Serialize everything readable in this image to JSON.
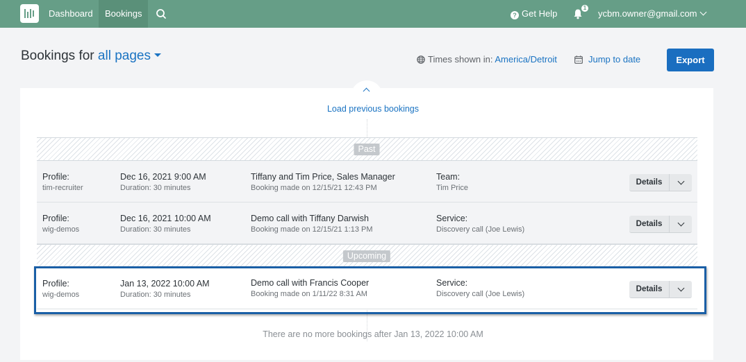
{
  "nav": {
    "items": [
      {
        "label": "Dashboard",
        "active": false
      },
      {
        "label": "Bookings",
        "active": true
      }
    ],
    "search_icon": "search-icon",
    "help_label": "Get Help",
    "notifications_count": "1",
    "user_email": "ycbm.owner@gmail.com"
  },
  "header": {
    "title_prefix": "Bookings for",
    "scope": "all pages",
    "times_shown_label": "Times shown in:",
    "timezone": "America/Detroit",
    "jump_to_date": "Jump to date",
    "export_label": "Export"
  },
  "list": {
    "load_previous": "Load previous bookings",
    "past_label": "Past",
    "upcoming_label": "Upcoming",
    "details_label": "Details",
    "past": [
      {
        "profile_label": "Profile:",
        "profile": "tim-recruiter",
        "datetime": "Dec 16, 2021 9:00 AM",
        "duration": "Duration: 30 minutes",
        "title": "Tiffany and Tim Price, Sales Manager",
        "booked": "Booking made on 12/15/21 12:43 PM",
        "type_label": "Team:",
        "type_value": "Tim Price"
      },
      {
        "profile_label": "Profile:",
        "profile": "wig-demos",
        "datetime": "Dec 16, 2021 10:00 AM",
        "duration": "Duration: 30 minutes",
        "title": "Demo call with Tiffany Darwish",
        "booked": "Booking made on 12/15/21 1:13 PM",
        "type_label": "Service:",
        "type_value": "Discovery call (Joe Lewis)"
      }
    ],
    "upcoming": [
      {
        "profile_label": "Profile:",
        "profile": "wig-demos",
        "datetime": "Jan 13, 2022 10:00 AM",
        "duration": "Duration: 30 minutes",
        "title": "Demo call with Francis Cooper",
        "booked": "Booking made on 1/11/22 8:31 AM",
        "type_label": "Service:",
        "type_value": "Discovery call (Joe Lewis)"
      }
    ],
    "no_more": "There are no more bookings after Jan 13, 2022 10:00 AM"
  }
}
